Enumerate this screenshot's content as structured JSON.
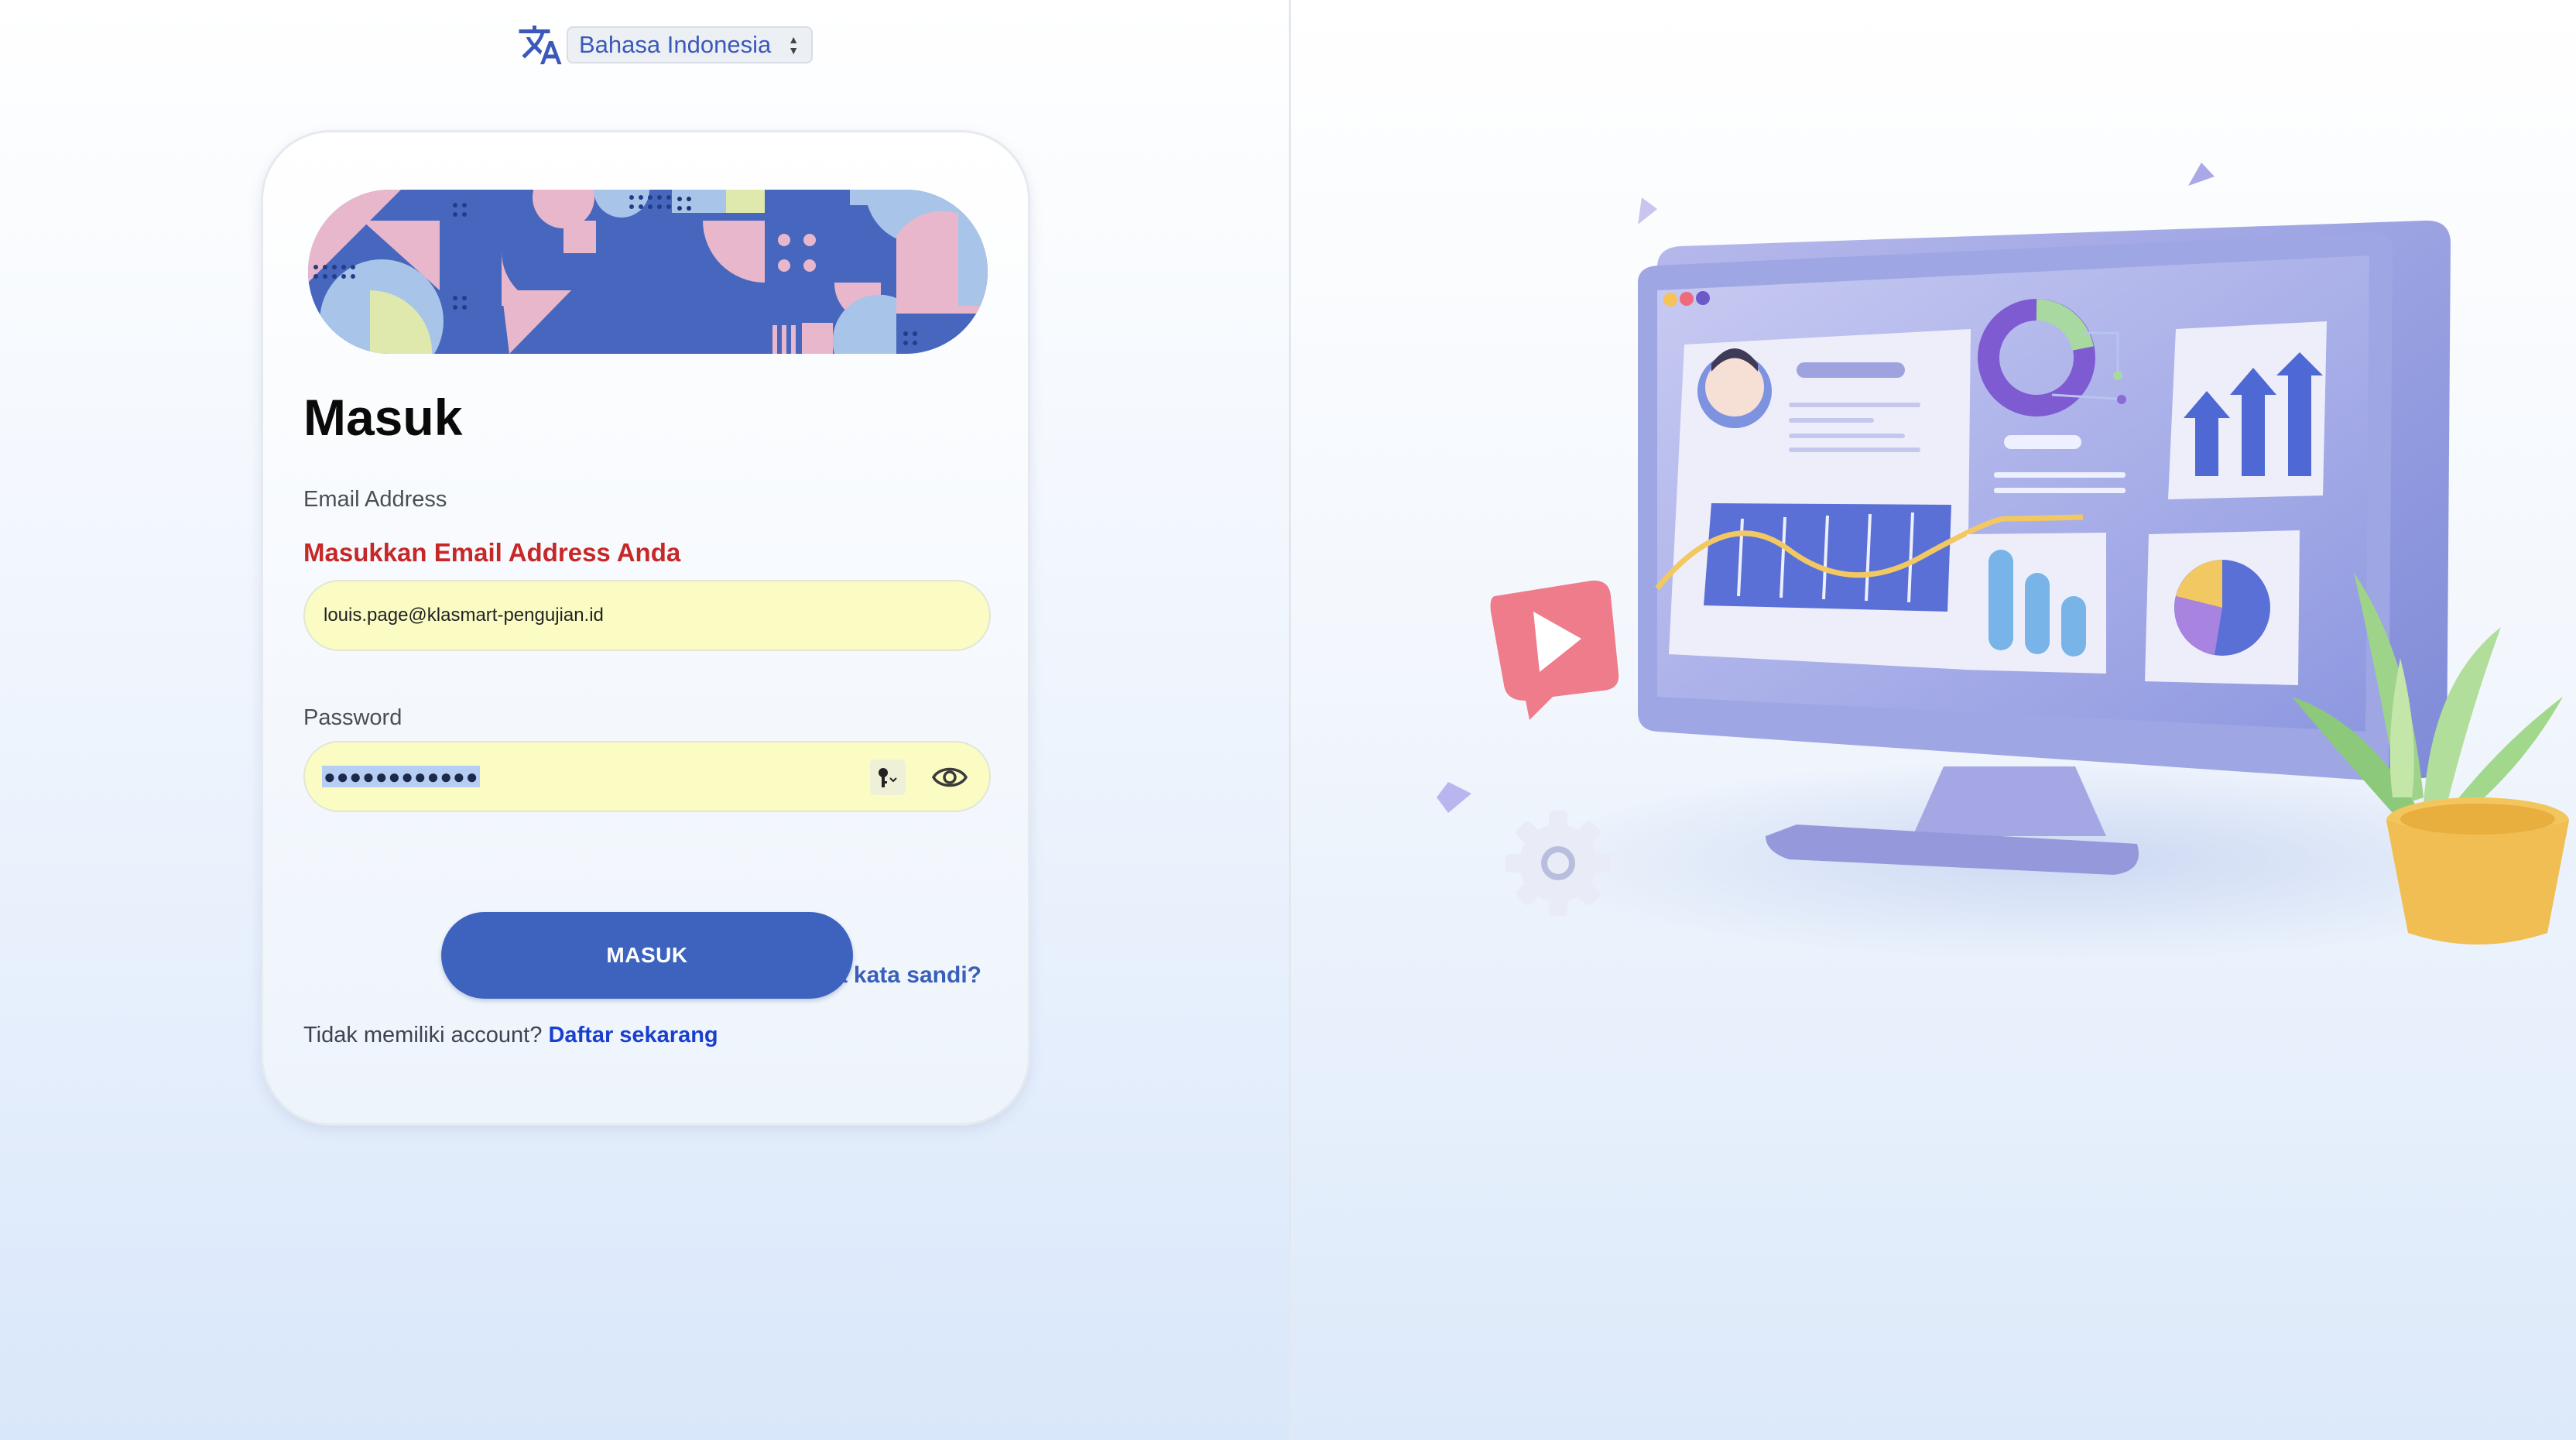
{
  "language": {
    "selected": "Bahasa Indonesia",
    "icon": "translate-icon"
  },
  "login": {
    "heading": "Masuk",
    "email_label": "Email Address",
    "email_error": "Masukkan Email Address Anda",
    "email_value": "louis.page@klasmart-pengujian.id",
    "password_label": "Password",
    "password_mask": "●●●●●●●●●●●●",
    "key_icon": "key-icon",
    "eye_icon": "eye-icon",
    "forgot_password": "Lupa kata sandi?",
    "submit": "MASUK",
    "no_account_text": "Tidak memiliki account?",
    "signup_link": "Daftar sekarang"
  },
  "colors": {
    "primary": "#3d63bf",
    "error": "#c62828",
    "autofill": "#fbfcc4",
    "link": "#1a3fcf"
  }
}
